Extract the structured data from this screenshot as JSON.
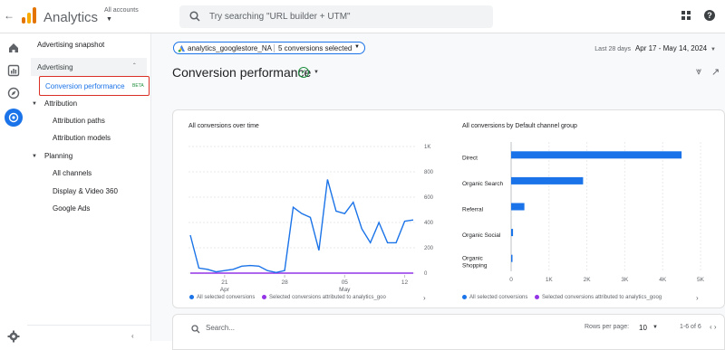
{
  "header": {
    "app_title": "Analytics",
    "accounts_label": "All accounts",
    "search_placeholder": "Try searching \"URL builder + UTM\"",
    "colors": {
      "logo_dark": "#e37400",
      "logo_light": "#f9ab00",
      "accent": "#1a73e8"
    }
  },
  "sidebar": {
    "items": [
      {
        "label": "Advertising snapshot"
      },
      {
        "label": "Advertising"
      },
      {
        "label": "Conversion performance",
        "badge": "BETA",
        "active": true
      },
      {
        "label": "Attribution"
      },
      {
        "label": "Attribution paths"
      },
      {
        "label": "Attribution models"
      },
      {
        "label": "Planning"
      },
      {
        "label": "All channels"
      },
      {
        "label": "Display & Video 360"
      },
      {
        "label": "Google Ads"
      }
    ]
  },
  "toolbar": {
    "property_chip": "analytics_googlestore_NA",
    "conversions_chip": "5 conversions selected",
    "date_prefix": "Last 28 days",
    "date_range": "Apr 17 - May 14, 2024"
  },
  "page": {
    "title": "Conversion performance"
  },
  "chart_data": [
    {
      "type": "line",
      "title": "All conversions over time",
      "x_ticks": [
        "21 Apr",
        "28",
        "05 May",
        "12"
      ],
      "y_ticks": [
        "0",
        "200",
        "400",
        "600",
        "800",
        "1K"
      ],
      "ylim": [
        0,
        1000
      ],
      "series": [
        {
          "name": "All selected conversions",
          "color": "#1a73e8",
          "values": [
            300,
            40,
            30,
            10,
            20,
            30,
            55,
            60,
            55,
            20,
            5,
            20,
            520,
            470,
            440,
            180,
            740,
            490,
            470,
            560,
            350,
            240,
            400,
            240,
            240,
            410,
            420
          ]
        },
        {
          "name": "Selected conversions attributed to analytics_goo",
          "color": "#9334e6",
          "values": [
            0,
            0,
            0,
            0,
            0,
            0,
            0,
            0,
            0,
            0,
            0,
            0,
            0,
            0,
            0,
            0,
            0,
            0,
            0,
            0,
            0,
            0,
            0,
            0,
            0,
            0,
            0
          ]
        }
      ],
      "legend": [
        "All selected conversions",
        "Selected conversions attributed to analytics_goo"
      ]
    },
    {
      "type": "bar",
      "orientation": "horizontal",
      "title": "All conversions by Default channel group",
      "categories": [
        "Direct",
        "Organic Search",
        "Referral",
        "Organic Social",
        "Organic Shopping"
      ],
      "values": [
        4500,
        1900,
        350,
        50,
        30
      ],
      "x_ticks": [
        "0",
        "1K",
        "2K",
        "3K",
        "4K",
        "5K"
      ],
      "xlim": [
        0,
        5000
      ],
      "bar_color": "#1a73e8",
      "legend": [
        "All selected conversions",
        "Selected conversions attributed to analytics_goog"
      ],
      "legend_colors": [
        "#1a73e8",
        "#9334e6"
      ]
    }
  ],
  "table": {
    "search_placeholder": "Search...",
    "rows_per_page_label": "Rows per page:",
    "rows_per_page_value": "10",
    "page_info": "1-6 of 6"
  }
}
